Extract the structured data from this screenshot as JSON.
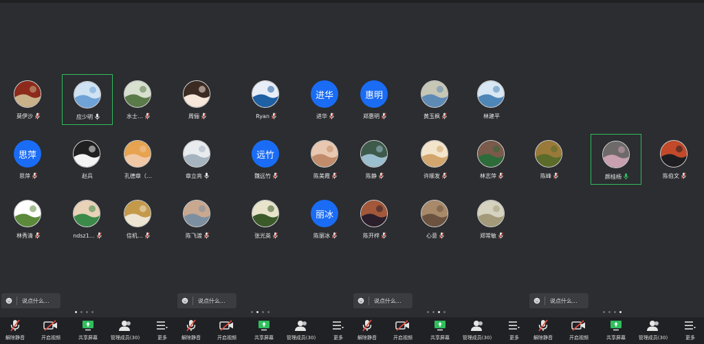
{
  "colors": {
    "accent": "#1a6cf5",
    "active_border": "#2fbf5e",
    "mic_muted": "#e74c3c",
    "mic_live": "#2fbf5e"
  },
  "panels": [
    {
      "participants": [
        {
          "name": "莫伊沙",
          "mic": "muted",
          "avatar": "photo-emblem",
          "col": 0,
          "row": 0
        },
        {
          "name": "应少明",
          "mic": "on",
          "avatar": "photo-sky",
          "col": 1,
          "row": 0,
          "active": true
        },
        {
          "name": "水士…",
          "mic": "muted",
          "avatar": "photo-waterfall",
          "col": 2,
          "row": 0
        },
        {
          "name": "赵兵",
          "mic": "none",
          "avatar": "photo-sketch",
          "col": 1,
          "row": 1
        },
        {
          "name": "孔德章（…",
          "mic": "none",
          "avatar": "photo-cartoon",
          "col": 2,
          "row": 1
        },
        {
          "name": "ndsz1…",
          "mic": "muted",
          "avatar": "photo-man",
          "col": 1,
          "row": 2
        },
        {
          "name": "信机…",
          "mic": "muted",
          "avatar": "photo-child",
          "col": 2,
          "row": 2
        },
        {
          "name": "思萍",
          "mic": "muted",
          "avatar": "initials",
          "initials": "思萍",
          "col": 0,
          "row": 1
        },
        {
          "name": "林秀清",
          "mic": "muted",
          "avatar": "photo-flower",
          "col": 0,
          "row": 2
        }
      ],
      "chat_placeholder": "说点什么...",
      "dots_active": 0
    },
    {
      "participants": [
        {
          "name": "周俪",
          "mic": "muted",
          "avatar": "photo-girl",
          "col": 0,
          "row": 0
        },
        {
          "name": "Ryan",
          "mic": "muted",
          "avatar": "photo-blue",
          "col": 1,
          "row": 0
        },
        {
          "name": "进华",
          "mic": "muted",
          "avatar": "initials",
          "initials": "进华",
          "col": 2,
          "row": 0
        },
        {
          "name": "章立亮",
          "mic": "on",
          "avatar": "photo-city",
          "col": 0,
          "row": 1
        },
        {
          "name": "魏远竹",
          "mic": "muted",
          "avatar": "initials",
          "initials": "远竹",
          "col": 1,
          "row": 1
        },
        {
          "name": "陈美霞",
          "mic": "muted",
          "avatar": "photo-selfie",
          "col": 2,
          "row": 1
        },
        {
          "name": "陈飞渡",
          "mic": "muted",
          "avatar": "photo-beach",
          "col": 0,
          "row": 2
        },
        {
          "name": "张光英",
          "mic": "muted",
          "avatar": "photo-flowers",
          "col": 1,
          "row": 2
        },
        {
          "name": "陈丽冰",
          "mic": "muted",
          "avatar": "initials",
          "initials": "丽冰",
          "col": 2,
          "row": 2
        }
      ],
      "chat_placeholder": "说点什么...",
      "dots_active": 1
    },
    {
      "participants": [
        {
          "name": "郑惠明",
          "mic": "muted",
          "avatar": "initials",
          "initials": "惠明",
          "col": 0,
          "row": 0
        },
        {
          "name": "黄玉枫",
          "mic": "muted",
          "avatar": "photo-landscape",
          "col": 1,
          "row": 0
        },
        {
          "name": "林建平",
          "mic": "none",
          "avatar": "photo-sea",
          "col": 2,
          "row": 0
        },
        {
          "name": "陈静",
          "mic": "muted",
          "avatar": "photo-valley",
          "col": 0,
          "row": 1
        },
        {
          "name": "许顺发",
          "mic": "muted",
          "avatar": "photo-dog",
          "col": 1,
          "row": 1
        },
        {
          "name": "林志萍",
          "mic": "muted",
          "avatar": "photo-woman",
          "col": 2,
          "row": 1
        },
        {
          "name": "陈开梓",
          "mic": "muted",
          "avatar": "photo-sunset",
          "col": 0,
          "row": 2
        },
        {
          "name": "心意",
          "mic": "muted",
          "avatar": "photo-animal",
          "col": 1,
          "row": 2
        },
        {
          "name": "郑常敏",
          "mic": "muted",
          "avatar": "photo-river",
          "col": 2,
          "row": 2
        }
      ],
      "chat_placeholder": "说点什么...",
      "dots_active": 2
    },
    {
      "participants": [
        {
          "name": "陈峰",
          "mic": "muted",
          "avatar": "photo-fruit",
          "col": 0,
          "row": 1
        },
        {
          "name": "颜桂杨",
          "mic": "live",
          "avatar": "photo-pink",
          "col": 1,
          "row": 1,
          "active": true
        },
        {
          "name": "陈伯文",
          "mic": "muted",
          "avatar": "photo-dark",
          "col": 2,
          "row": 1
        }
      ],
      "chat_placeholder": "说点什么...",
      "dots_active": 3
    }
  ],
  "toolbar": {
    "unmute": "解除静音",
    "start_video": "开启视频",
    "share_screen": "共享屏幕",
    "manage_members": "管理成员(30)",
    "more": "更多"
  }
}
